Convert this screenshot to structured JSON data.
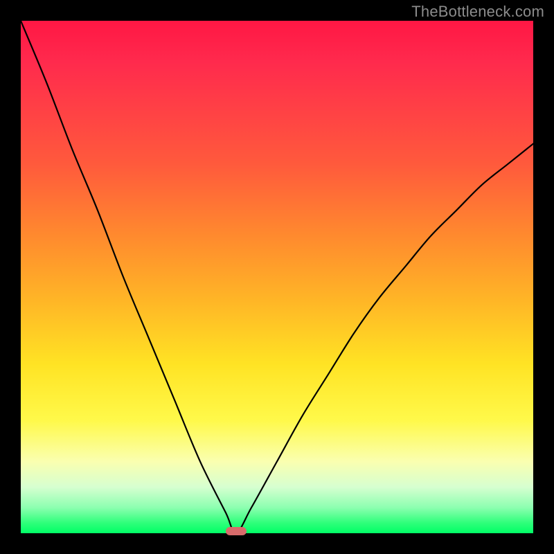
{
  "watermark": "TheBottleneck.com",
  "chart_data": {
    "type": "line",
    "title": "",
    "xlabel": "",
    "ylabel": "",
    "xlim": [
      0,
      100
    ],
    "ylim": [
      0,
      100
    ],
    "grid": false,
    "legend": false,
    "background_gradient": {
      "top": "#ff1744",
      "mid": "#ffe324",
      "bottom": "#00ff66"
    },
    "series": [
      {
        "name": "bottleneck-curve-left",
        "x": [
          0,
          5,
          10,
          15,
          20,
          25,
          30,
          35,
          40,
          42
        ],
        "values": [
          100,
          88,
          75,
          63,
          50,
          38,
          26,
          14,
          4,
          0
        ]
      },
      {
        "name": "bottleneck-curve-right",
        "x": [
          42,
          45,
          50,
          55,
          60,
          65,
          70,
          75,
          80,
          85,
          90,
          95,
          100
        ],
        "values": [
          0,
          5,
          14,
          23,
          31,
          39,
          46,
          52,
          58,
          63,
          68,
          72,
          76
        ]
      }
    ],
    "marker": {
      "name": "optimal-point",
      "x": 42,
      "y": 0,
      "color": "#d86b6b"
    }
  }
}
